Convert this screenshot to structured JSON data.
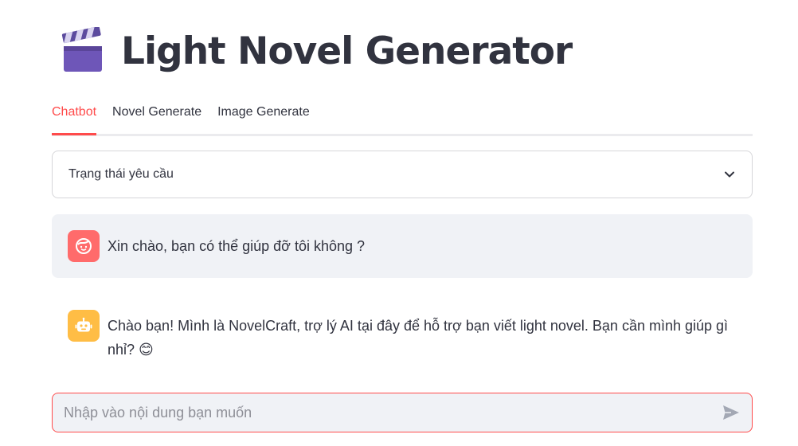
{
  "header": {
    "title": "Light Novel Generator",
    "title_icon": "clapper-board-icon"
  },
  "tabs": [
    {
      "label": "Chatbot",
      "active": true
    },
    {
      "label": "Novel Generate",
      "active": false
    },
    {
      "label": "Image Generate",
      "active": false
    }
  ],
  "status_expander": {
    "label": "Trạng thái yêu cầu",
    "icon": "chevron-down-icon"
  },
  "messages": [
    {
      "role": "user",
      "avatar_icon": "user-face-icon",
      "text": "Xin chào, bạn có thể giúp đỡ tôi không ?"
    },
    {
      "role": "assistant",
      "avatar_icon": "robot-icon",
      "text": "Chào bạn! Mình là NovelCraft, trợ lý AI tại đây để hỗ trợ bạn viết light novel. Bạn cần mình giúp gì nhỉ? 😊"
    }
  ],
  "chat_input": {
    "placeholder": "Nhập vào nội dung bạn muốn",
    "value": "",
    "send_icon": "send-icon"
  },
  "colors": {
    "accent": "#ff4b4b",
    "user_avatar": "#ff6b6b",
    "assistant_avatar": "#ffbd45",
    "message_bg": "#f0f2f6",
    "text": "#31333f"
  }
}
